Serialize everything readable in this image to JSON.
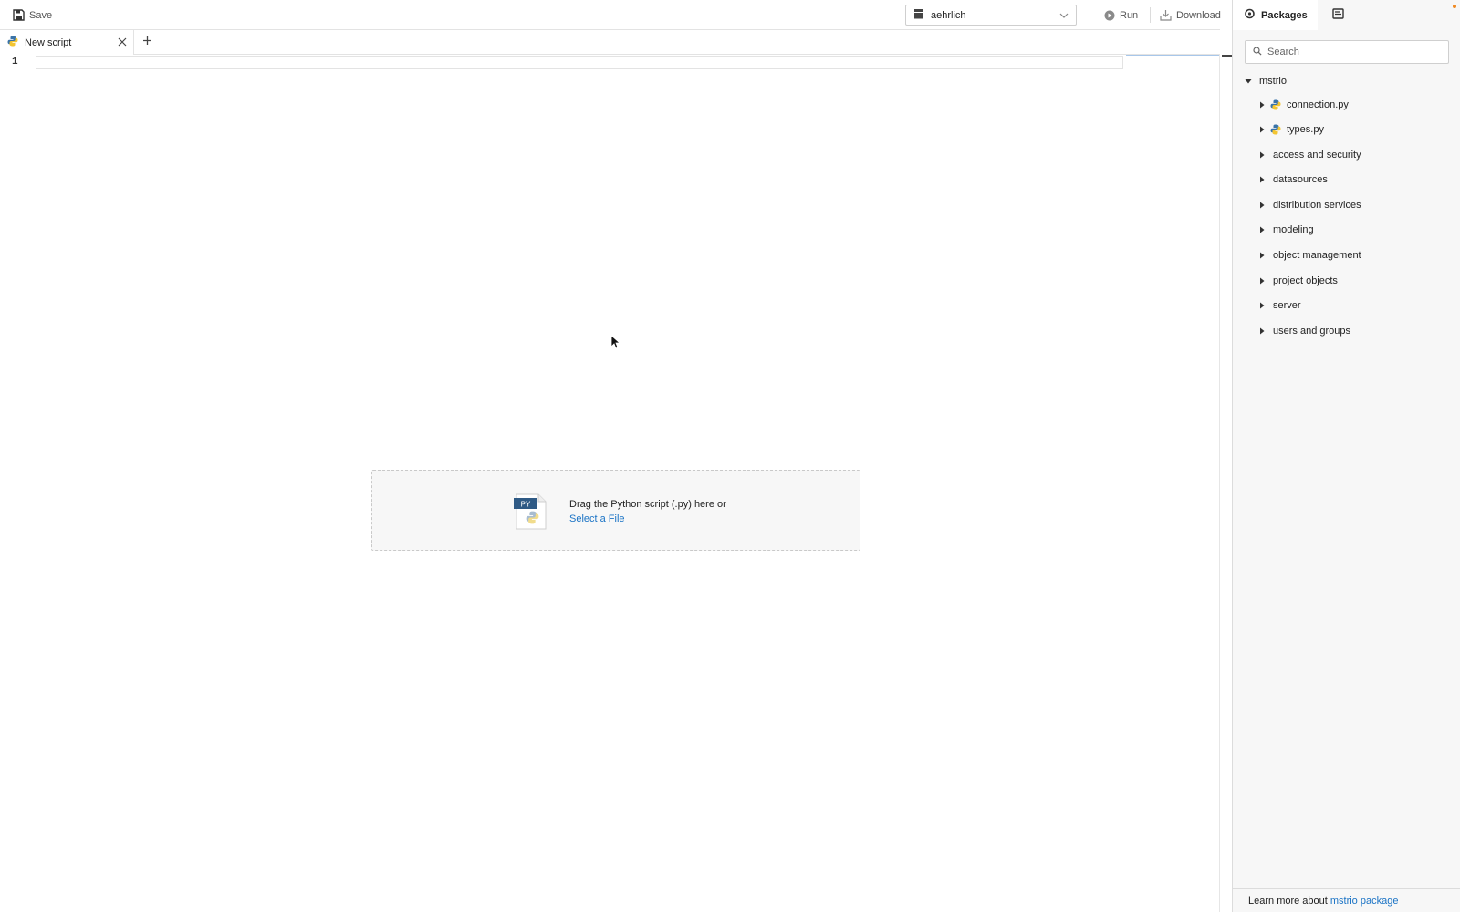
{
  "toolbar": {
    "save_label": "Save",
    "environment": "aehrlich",
    "run_label": "Run",
    "download_label": "Download"
  },
  "tabs": [
    {
      "label": "New script",
      "icon": "python-icon",
      "active": true
    }
  ],
  "editor": {
    "line_numbers": [
      "1"
    ]
  },
  "dropzone": {
    "badge": "PY",
    "text": "Drag the Python script (.py) here or",
    "link": "Select a File"
  },
  "panel": {
    "tabs": [
      {
        "label": "Packages",
        "icon": "packages-icon",
        "active": true
      },
      {
        "label": "",
        "icon": "script-panel-icon",
        "active": false
      }
    ],
    "search_placeholder": "Search",
    "tree": {
      "root": "mstrio",
      "files": [
        "connection.py",
        "types.py"
      ],
      "folders": [
        "access and security",
        "datasources",
        "distribution services",
        "modeling",
        "object management",
        "project objects",
        "server",
        "users and groups"
      ]
    },
    "footer": {
      "text": "Learn more about",
      "link": "mstrio package"
    }
  },
  "colors": {
    "accent_link": "#1a73c5",
    "notification": "#f08a24",
    "panel_bg": "#f7f7f7"
  }
}
